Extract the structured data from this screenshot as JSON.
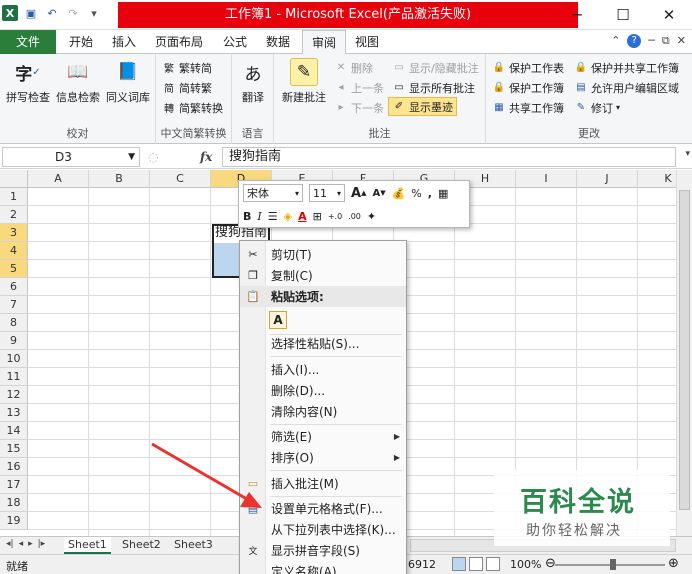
{
  "window": {
    "title": "工作簿1 - Microsoft Excel(产品激活失败)",
    "minimize": "─",
    "maximize": "☐",
    "close": "✕"
  },
  "qat": {
    "logo": "X"
  },
  "tabs": {
    "file": "文件",
    "items": [
      "开始",
      "插入",
      "页面布局",
      "公式",
      "数据",
      "审阅",
      "视图"
    ],
    "active": "审阅"
  },
  "ribbon": {
    "proofing": {
      "label": "校对",
      "spell": "拼写检查",
      "research": "信息检索",
      "thesaurus": "同义词库"
    },
    "chinese": {
      "label": "中文简繁转换",
      "to_simplified": "繁转简",
      "to_traditional": "简转繁",
      "convert": "简繁转换"
    },
    "language": {
      "label": "语言",
      "translate": "翻译"
    },
    "comments": {
      "label": "批注",
      "new": "新建批注",
      "delete": "删除",
      "previous": "上一条",
      "next": "下一条",
      "show_hide": "显示/隐藏批注",
      "show_all": "显示所有批注",
      "show_ink": "显示墨迹"
    },
    "changes": {
      "label": "更改",
      "protect_sheet": "保护工作表",
      "protect_workbook": "保护工作簿",
      "share_workbook": "共享工作簿",
      "protect_share": "保护并共享工作簿",
      "allow_edit": "允许用户编辑区域",
      "track": "修订"
    }
  },
  "formula_bar": {
    "name_box": "D3",
    "fx": "fx",
    "value": "搜狗指南"
  },
  "grid": {
    "columns": [
      "A",
      "B",
      "C",
      "D",
      "E",
      "F",
      "G",
      "H",
      "I",
      "J",
      "K"
    ],
    "rows": [
      "1",
      "2",
      "3",
      "4",
      "5",
      "6",
      "7",
      "8",
      "9",
      "10",
      "11",
      "12",
      "13",
      "14",
      "15",
      "16",
      "17",
      "18",
      "19"
    ],
    "active_cell_text": "搜狗指南"
  },
  "mini_toolbar": {
    "font": "宋体",
    "size": "11",
    "grow": "A",
    "shrink": "A",
    "percent": "%",
    "comma": ",",
    "bold": "B",
    "italic": "I",
    "font_color": "A"
  },
  "context_menu": {
    "cut": "剪切(T)",
    "copy": "复制(C)",
    "paste_options": "粘贴选项:",
    "paste_option_a": "A",
    "paste_special": "选择性粘贴(S)...",
    "insert": "插入(I)...",
    "delete": "删除(D)...",
    "clear": "清除内容(N)",
    "filter": "筛选(E)",
    "sort": "排序(O)",
    "insert_comment": "插入批注(M)",
    "format_cells": "设置单元格格式(F)...",
    "pick_list": "从下拉列表中选择(K)...",
    "phonetic": "显示拼音字段(S)",
    "define_name": "定义名称(A)..."
  },
  "sheets": {
    "tabs": [
      "Sheet1",
      "Sheet2",
      "Sheet3"
    ],
    "active": "Sheet1"
  },
  "status": {
    "ready": "就绪",
    "count": "6912",
    "zoom": "100%"
  },
  "watermark": {
    "title": "百科全说",
    "subtitle": "助你轻松解决"
  },
  "colors": {
    "excel_green": "#1e7145",
    "title_red": "#e8000c",
    "selection_blue": "#bcd6f0",
    "header_highlight": "#f9d97e",
    "annotation_red": "#e8332f",
    "watermark_green": "#2c8a4e"
  }
}
